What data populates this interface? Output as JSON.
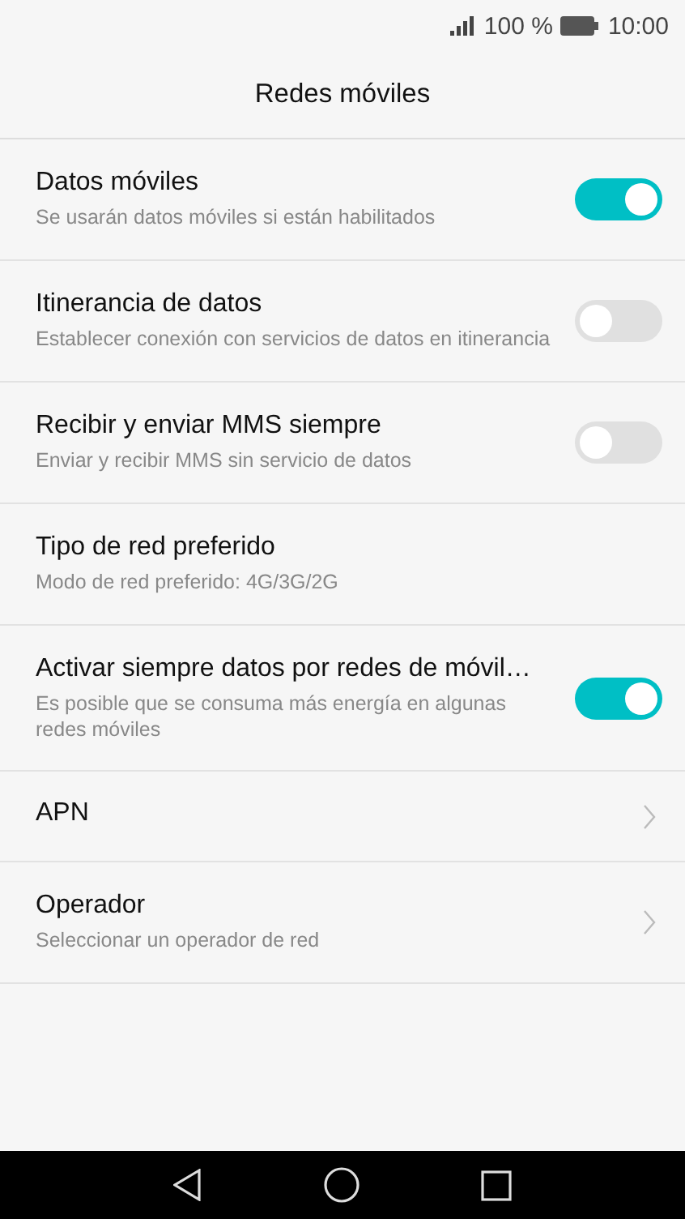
{
  "status_bar": {
    "battery_text": "100 %",
    "time": "10:00"
  },
  "title": "Redes móviles",
  "items": [
    {
      "kind": "switch",
      "title": "Datos móviles",
      "subtitle": "Se usarán datos móviles si están habilitados",
      "on": true
    },
    {
      "kind": "switch",
      "title": "Itinerancia de datos",
      "subtitle": "Establecer conexión con servicios de datos en itinerancia",
      "on": false
    },
    {
      "kind": "switch",
      "title": "Recibir y enviar MMS siempre",
      "subtitle": "Enviar y recibir MMS sin servicio de datos",
      "on": false
    },
    {
      "kind": "plain",
      "title": "Tipo de red preferido",
      "subtitle": "Modo de red preferido: 4G/3G/2G"
    },
    {
      "kind": "switch",
      "title": "Activar siempre datos por redes de móvil…",
      "subtitle": "Es posible que se consuma más energía en algunas redes móviles",
      "on": true
    },
    {
      "kind": "link",
      "title": "APN"
    },
    {
      "kind": "link",
      "title": "Operador",
      "subtitle": "Seleccionar un operador de red"
    }
  ]
}
